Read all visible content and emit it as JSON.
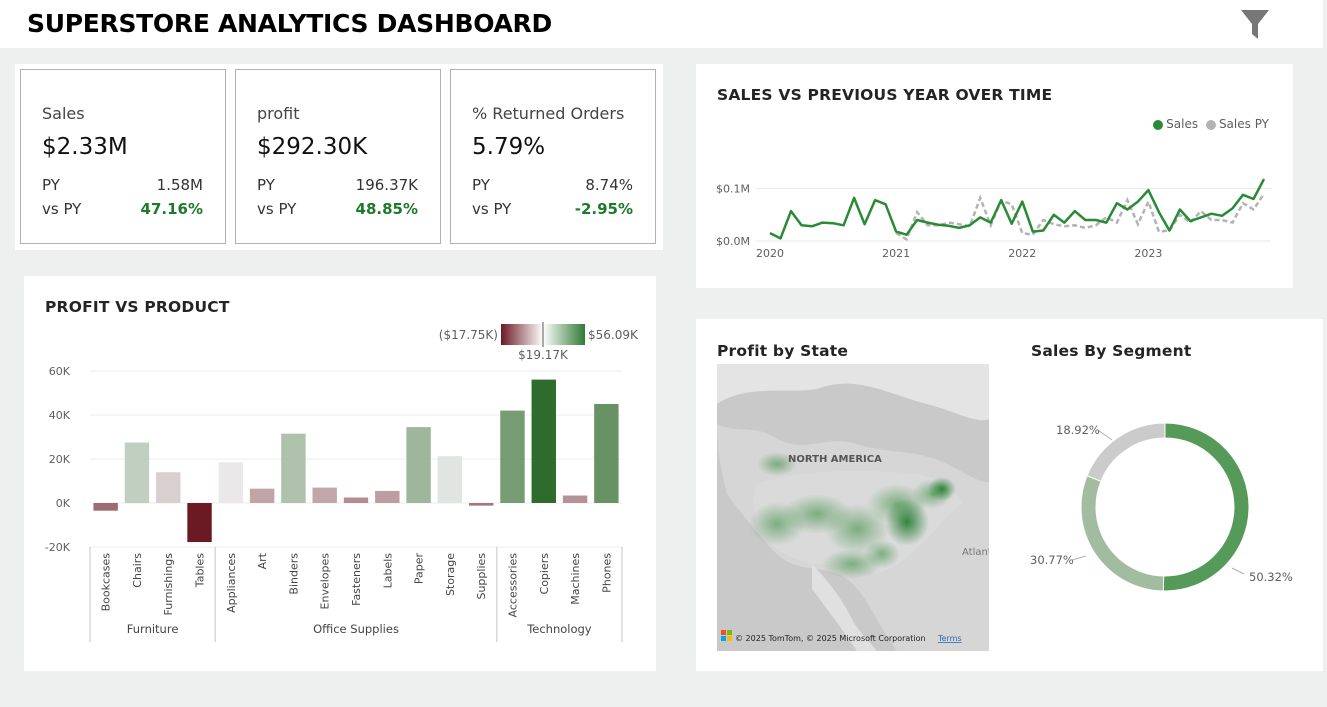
{
  "header": {
    "title": "SUPERSTORE ANALYTICS DASHBOARD",
    "filter_icon": "filter-icon"
  },
  "kpis": [
    {
      "label": "Sales",
      "value": "$2.33M",
      "py_label": "PY",
      "py_value": "1.58M",
      "vs_label": "vs PY",
      "vs_value": "47.16%"
    },
    {
      "label": "profit",
      "value": "$292.30K",
      "py_label": "PY",
      "py_value": "196.37K",
      "vs_label": "vs PY",
      "vs_value": "48.85%"
    },
    {
      "label": "% Returned Orders",
      "value": "5.79%",
      "py_label": "PY",
      "py_value": "8.74%",
      "vs_label": "vs PY",
      "vs_value": "-2.95%"
    }
  ],
  "colors": {
    "positive": "#1d7a2b",
    "sales_line": "#2b8a36",
    "py_line": "#b3b3b3",
    "neg_dark": "#6b1a24",
    "pos_dark": "#2f6b2a"
  },
  "chart_data": [
    {
      "type": "line",
      "title": "SALES VS PREVIOUS YEAR OVER TIME",
      "legend": [
        "Sales",
        "Sales PY"
      ],
      "legend_position": "top-right",
      "x_ticks": [
        "2020",
        "2021",
        "2022",
        "2023"
      ],
      "y_ticks": [
        "$0.0M",
        "$0.1M"
      ],
      "ylim": [
        0,
        0.12
      ],
      "x": [
        "2020-01",
        "2020-02",
        "2020-03",
        "2020-04",
        "2020-05",
        "2020-06",
        "2020-07",
        "2020-08",
        "2020-09",
        "2020-10",
        "2020-11",
        "2020-12",
        "2021-01",
        "2021-02",
        "2021-03",
        "2021-04",
        "2021-05",
        "2021-06",
        "2021-07",
        "2021-08",
        "2021-09",
        "2021-10",
        "2021-11",
        "2021-12",
        "2022-01",
        "2022-02",
        "2022-03",
        "2022-04",
        "2022-05",
        "2022-06",
        "2022-07",
        "2022-08",
        "2022-09",
        "2022-10",
        "2022-11",
        "2022-12",
        "2023-01",
        "2023-02",
        "2023-03",
        "2023-04",
        "2023-05",
        "2023-06",
        "2023-07",
        "2023-08",
        "2023-09",
        "2023-10",
        "2023-11",
        "2023-12"
      ],
      "series": [
        {
          "name": "Sales",
          "values": [
            0.015,
            0.005,
            0.057,
            0.03,
            0.028,
            0.035,
            0.034,
            0.03,
            0.082,
            0.032,
            0.078,
            0.07,
            0.018,
            0.012,
            0.04,
            0.035,
            0.031,
            0.029,
            0.025,
            0.03,
            0.045,
            0.035,
            0.078,
            0.033,
            0.075,
            0.018,
            0.02,
            0.05,
            0.035,
            0.057,
            0.04,
            0.04,
            0.035,
            0.072,
            0.06,
            0.075,
            0.097,
            0.055,
            0.02,
            0.06,
            0.038,
            0.045,
            0.052,
            0.048,
            0.062,
            0.088,
            0.08,
            0.118
          ]
        },
        {
          "name": "Sales PY",
          "values": [
            null,
            null,
            null,
            null,
            null,
            null,
            null,
            null,
            null,
            null,
            null,
            null,
            0.015,
            0.003,
            0.055,
            0.03,
            0.03,
            0.035,
            0.032,
            0.028,
            0.082,
            0.03,
            0.077,
            0.07,
            0.015,
            0.012,
            0.04,
            0.032,
            0.028,
            0.03,
            0.025,
            0.03,
            0.045,
            0.035,
            0.078,
            0.032,
            0.075,
            0.018,
            0.02,
            0.05,
            0.035,
            0.057,
            0.04,
            0.04,
            0.035,
            0.072,
            0.06,
            0.09
          ]
        }
      ]
    },
    {
      "type": "bar",
      "title": "PROFIT VS PRODUCT",
      "ylim": [
        -20000,
        60000
      ],
      "y_ticks": [
        "-20K",
        "0K",
        "20K",
        "40K",
        "60K"
      ],
      "gradient_legend": {
        "min": "($17.75K)",
        "mid": "$19.17K",
        "max": "$56.09K"
      },
      "groups": [
        {
          "name": "Furniture",
          "categories": [
            "Bookcases",
            "Chairs",
            "Furnishings",
            "Tables"
          ],
          "values": [
            -3500,
            27500,
            14000,
            -17750
          ]
        },
        {
          "name": "Office Supplies",
          "categories": [
            "Appliances",
            "Art",
            "Binders",
            "Envelopes",
            "Fasteners",
            "Labels",
            "Paper",
            "Storage",
            "Supplies"
          ],
          "values": [
            18500,
            6500,
            31500,
            7000,
            2500,
            5500,
            34500,
            21300,
            -1200
          ]
        },
        {
          "name": "Technology",
          "categories": [
            "Accessories",
            "Copiers",
            "Machines",
            "Phones"
          ],
          "values": [
            42000,
            56090,
            3400,
            45000
          ]
        }
      ]
    },
    {
      "type": "pie",
      "title": "Sales By Segment",
      "labels": [
        "50.32%",
        "30.77%",
        "18.92%"
      ],
      "values": [
        50.32,
        30.77,
        18.92
      ]
    }
  ],
  "map": {
    "title": "Profit by State",
    "label_continent": "NORTH AMERICA",
    "label_ocean": "Atlant",
    "copyright": "© 2025 TomTom, © 2025 Microsoft Corporation",
    "terms": "Terms"
  }
}
